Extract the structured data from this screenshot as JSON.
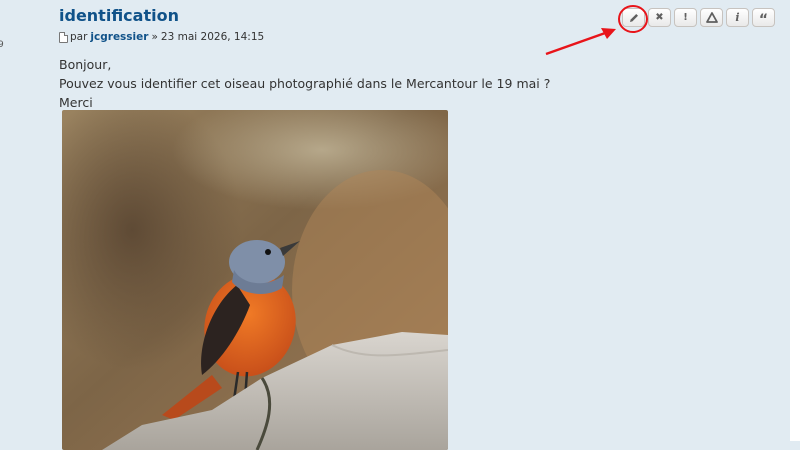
{
  "post": {
    "title": "identification",
    "author_prefix": "par",
    "author": "jcgressier",
    "separator": "»",
    "date": "23 mai 2026, 14:15",
    "lines": [
      "Bonjour,",
      "Pouvez vous identifier cet oiseau photographié dans le Mercantour le 19 mai ?",
      "Merci"
    ]
  },
  "actions": [
    {
      "name": "edit-icon",
      "glyph": "pencil"
    },
    {
      "name": "delete-icon",
      "glyph": "✖"
    },
    {
      "name": "report-icon",
      "glyph": "!"
    },
    {
      "name": "warn-icon",
      "glyph": "triangle"
    },
    {
      "name": "info-icon",
      "glyph": "i"
    },
    {
      "name": "quote-icon",
      "glyph": "“"
    }
  ],
  "gutter_fragment": "9",
  "colors": {
    "background": "#e1ebf2",
    "link": "#105289",
    "text": "#333333",
    "annotation": "#e8141a"
  }
}
